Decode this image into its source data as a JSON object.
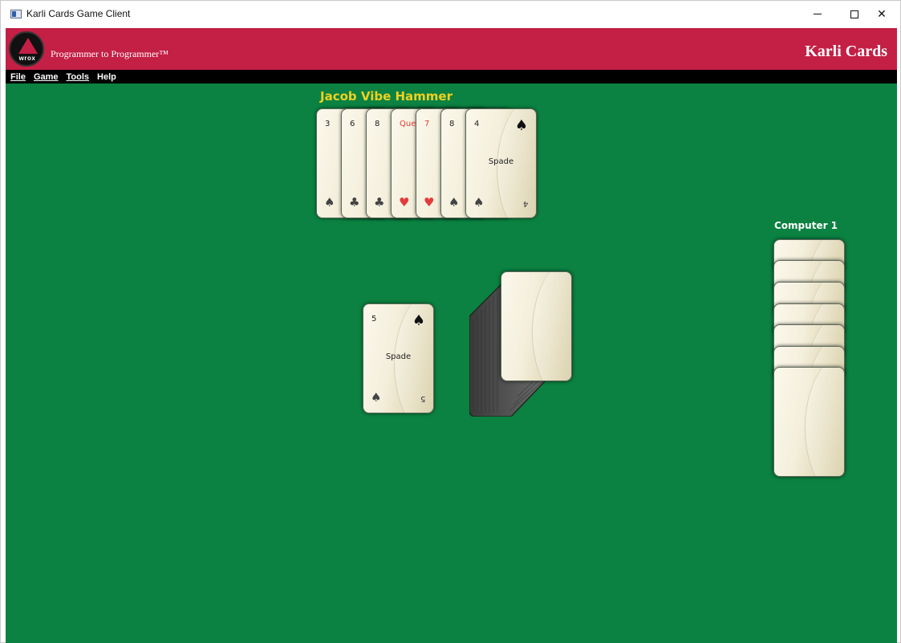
{
  "window": {
    "title": "Karli Cards Game Client",
    "controls": {
      "minimize": "minimize",
      "maximize": "maximize",
      "close": "✕"
    }
  },
  "banner": {
    "logo_text": "wrox",
    "tagline": "Programmer to Programmer™",
    "brand": "Karli Cards",
    "color": "#c41f45"
  },
  "menu": {
    "items": [
      "File",
      "Game",
      "Tools",
      "Help"
    ]
  },
  "table": {
    "color": "#0b8241",
    "player": {
      "name": "Jacob Vibe Hammer",
      "hand": [
        {
          "rank": "3",
          "suit_symbol": "♠",
          "color": "black"
        },
        {
          "rank": "6",
          "suit_symbol": "♣",
          "color": "black"
        },
        {
          "rank": "8",
          "suit_symbol": "♣",
          "color": "black"
        },
        {
          "rank": "Que",
          "suit_symbol": "♥",
          "color": "red"
        },
        {
          "rank": "7",
          "suit_symbol": "♥",
          "color": "red"
        },
        {
          "rank": "8",
          "suit_symbol": "♠",
          "color": "black"
        },
        {
          "rank": "4",
          "suit_symbol": "♠",
          "suit_name": "Spade",
          "color": "black"
        }
      ]
    },
    "computer": {
      "name": "Computer 1",
      "card_count": 7
    },
    "discard": {
      "rank": "5",
      "suit_symbol": "♠",
      "suit_name": "Spade"
    },
    "deck": {
      "label": "deck"
    }
  }
}
